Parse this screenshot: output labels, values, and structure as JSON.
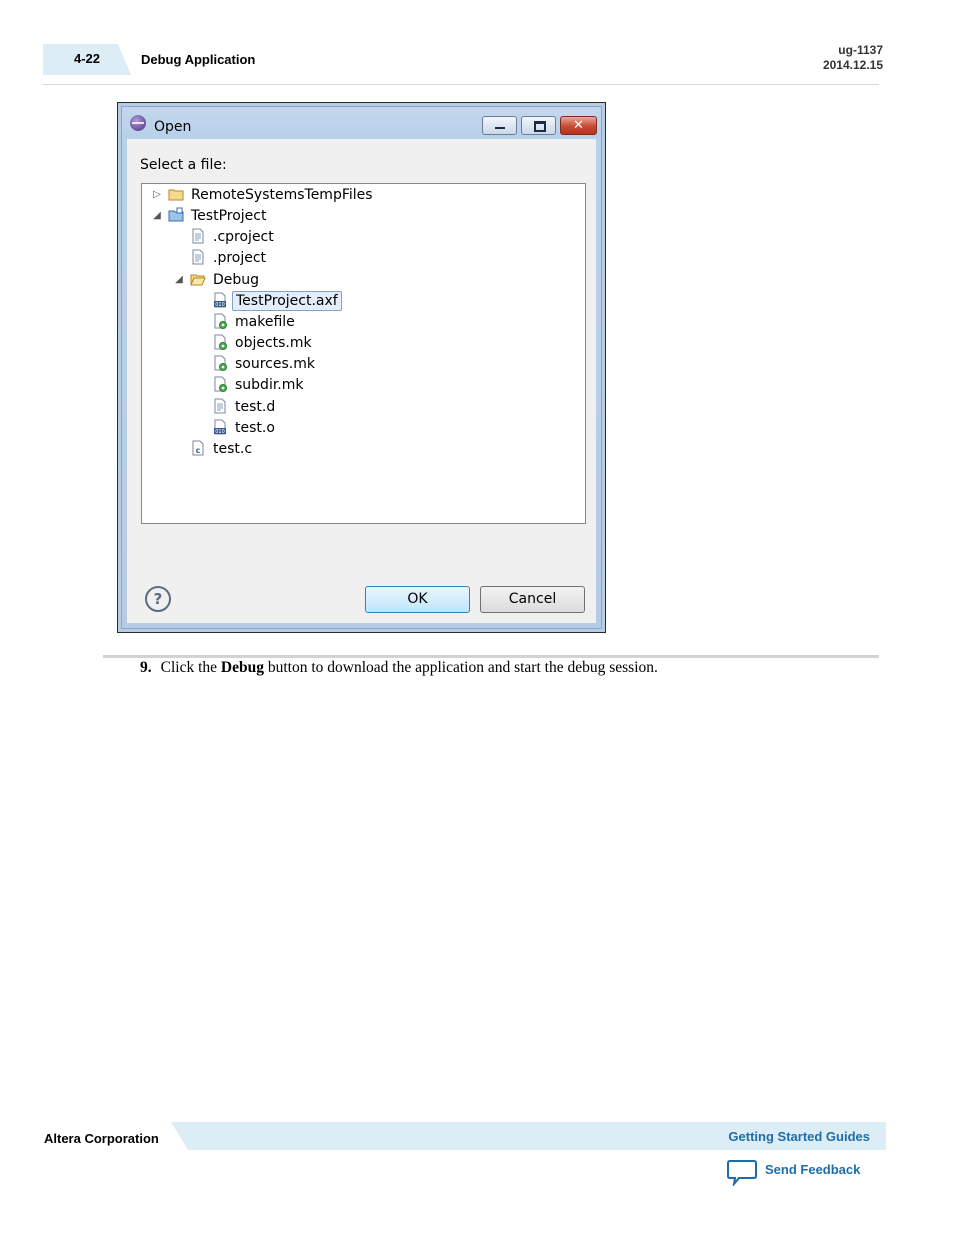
{
  "header": {
    "page_number": "4-22",
    "section_title": "Debug Application",
    "doc_id": "ug-1137",
    "date": "2014.12.15"
  },
  "dialog": {
    "title": "Open",
    "prompt": "Select a file:",
    "tree": [
      {
        "label": "RemoteSystemsTempFiles",
        "icon": "folder-icon",
        "expander": "collapsed"
      },
      {
        "label": "TestProject",
        "icon": "project-folder-icon",
        "expander": "expanded"
      },
      {
        "label": ".cproject",
        "icon": "text-file-icon"
      },
      {
        "label": ".project",
        "icon": "text-file-icon"
      },
      {
        "label": "Debug",
        "icon": "open-folder-icon",
        "expander": "expanded"
      },
      {
        "label": "TestProject.axf",
        "icon": "binary-file-icon",
        "selected": true
      },
      {
        "label": "makefile",
        "icon": "make-file-icon"
      },
      {
        "label": "objects.mk",
        "icon": "make-file-icon"
      },
      {
        "label": "sources.mk",
        "icon": "make-file-icon"
      },
      {
        "label": "subdir.mk",
        "icon": "make-file-icon"
      },
      {
        "label": "test.d",
        "icon": "text-file-icon"
      },
      {
        "label": "test.o",
        "icon": "binary-file-icon"
      },
      {
        "label": "test.c",
        "icon": "c-file-icon"
      }
    ],
    "help": "?",
    "close_glyph": "✕",
    "ok_label": "OK",
    "cancel_label": "Cancel"
  },
  "step": {
    "number": "9.",
    "before": "Click the ",
    "bold": "Debug",
    "after": " button to download the application and start the debug session."
  },
  "footer": {
    "company": "Altera Corporation",
    "guides_link": "Getting Started Guides",
    "feedback_link": "Send Feedback"
  }
}
